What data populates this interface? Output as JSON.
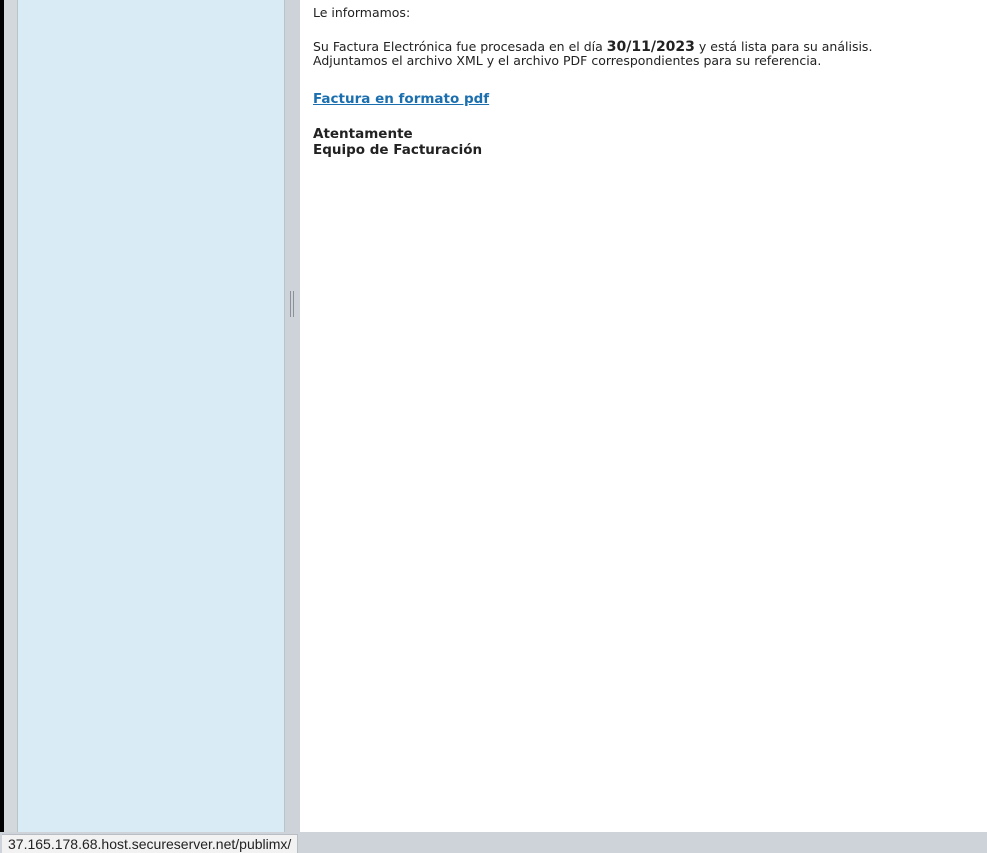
{
  "message": {
    "greeting": "Le informamos:",
    "line1_before": "Su Factura Electrónica fue procesada en el día ",
    "line1_date": "30/11/2023",
    "line1_after": " y está lista para su análisis.",
    "line2": "Adjuntamos el archivo XML y el archivo PDF correspondientes para su referencia.",
    "link_text": "Factura en formato pdf",
    "closing_line1": "Atentamente",
    "closing_line2": "Equipo de Facturación"
  },
  "status_bar": {
    "url": "37.165.178.68.host.secureserver.net/publimx/"
  },
  "colors": {
    "side_panel": "#d9ebf4",
    "link": "#1b6fae",
    "chrome": "#cdd3d8"
  }
}
